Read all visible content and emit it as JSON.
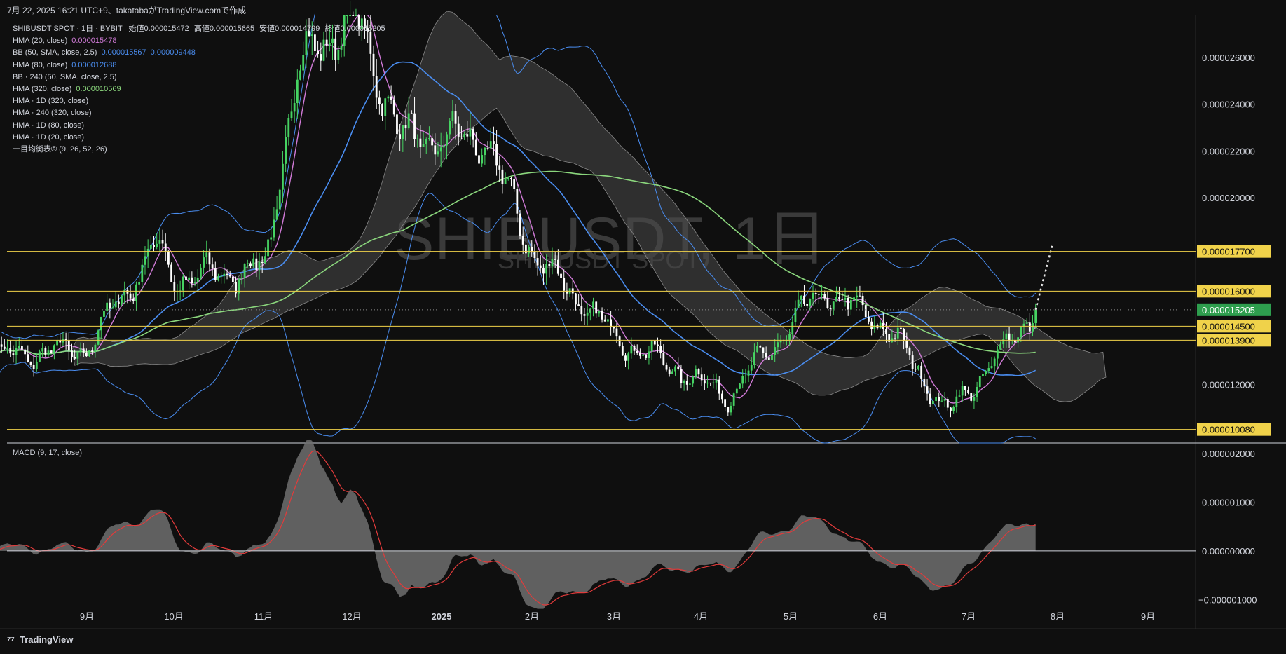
{
  "header": {
    "snapshot_line": "7月 22, 2025 16:21 UTC+9、takatabaがTradingView.comで作成",
    "watermark_symbol": "SHIBUSDT, 1日",
    "watermark_sub": "SHIBUSDT SPOT"
  },
  "legend": {
    "main": {
      "prefix": "SHIBUSDT SPOT · 1日 · BYBIT",
      "open_label": "始値",
      "open": "0.000015472",
      "high_label": "高値",
      "high": "0.000015665",
      "low_label": "安値",
      "low": "0.000014799",
      "close_label": "終値",
      "close": "0.000015205"
    },
    "indicators": [
      {
        "label": "HMA (20, close)",
        "value": "0.000015478",
        "color": "#d17bd8"
      },
      {
        "label": "BB (50, SMA, close, 2.5)",
        "value": "0.000015567",
        "value2": "0.000009448",
        "color": "#4a8df0"
      },
      {
        "label": "HMA (80, close)",
        "value": "0.000012688",
        "color": "#4a8df0"
      },
      {
        "label": "BB · 240 (50, SMA, close, 2.5)",
        "value": "",
        "color": ""
      },
      {
        "label": "HMA (320, close)",
        "value": "0.000010569",
        "color": "#8bd77d"
      },
      {
        "label": "HMA · 1D (320, close)",
        "value": "",
        "color": ""
      },
      {
        "label": "HMA · 240 (320, close)",
        "value": "",
        "color": ""
      },
      {
        "label": "HMA · 1D (80, close)",
        "value": "",
        "color": ""
      },
      {
        "label": "HMA · 1D (20, close)",
        "value": "",
        "color": ""
      },
      {
        "label": "一目均衡表® (9, 26, 52, 26)",
        "value": "",
        "color": ""
      }
    ]
  },
  "chart_data": [
    {
      "type": "candlestick",
      "title": "SHIBUSDT SPOT · 1日 · BYBIT",
      "x_ticks": [
        "9月",
        "10月",
        "11月",
        "12月",
        "2025",
        "2月",
        "3月",
        "4月",
        "5月",
        "6月",
        "7月",
        "8月",
        "9月"
      ],
      "y_ticks": [
        "0.000026000",
        "0.000024000",
        "0.000022000",
        "0.000020000",
        "0.000012000"
      ],
      "ylim": [
        9.5e-06,
        2.78e-05
      ],
      "horizontal_levels": [
        {
          "value": 1.77e-05,
          "label": "0.000017700",
          "color": "#f0d24a"
        },
        {
          "value": 1.6e-05,
          "label": "0.000016000",
          "color": "#f0d24a"
        },
        {
          "value": 1.45e-05,
          "label": "0.000014500",
          "color": "#f0d24a"
        },
        {
          "value": 1.39e-05,
          "label": "0.000013900",
          "color": "#f0d24a"
        },
        {
          "value": 1.008e-05,
          "label": "0.000010080",
          "color": "#f0d24a"
        }
      ],
      "last_price": {
        "value": 1.5205e-05,
        "label": "0.000015205",
        "color": "#2e9e4e"
      },
      "close_path_monthly": [
        {
          "x": "2024-08-01",
          "close": 1.32e-05
        },
        {
          "x": "2024-09-01",
          "close": 1.35e-05
        },
        {
          "x": "2024-09-25",
          "close": 1.8e-05
        },
        {
          "x": "2024-10-01",
          "close": 1.65e-05
        },
        {
          "x": "2024-11-01",
          "close": 1.7e-05
        },
        {
          "x": "2024-11-12",
          "close": 2.55e-05
        },
        {
          "x": "2024-12-01",
          "close": 2.8e-05
        },
        {
          "x": "2024-12-18",
          "close": 2.25e-05
        },
        {
          "x": "2025-01-15",
          "close": 2.25e-05
        },
        {
          "x": "2025-02-01",
          "close": 1.75e-05
        },
        {
          "x": "2025-03-01",
          "close": 1.4e-05
        },
        {
          "x": "2025-04-08",
          "close": 1.15e-05
        },
        {
          "x": "2025-05-10",
          "close": 1.6e-05
        },
        {
          "x": "2025-06-01",
          "close": 1.45e-05
        },
        {
          "x": "2025-06-22",
          "close": 1.08e-05
        },
        {
          "x": "2025-07-01",
          "close": 1.2e-05
        },
        {
          "x": "2025-07-22",
          "close": 1.52e-05
        }
      ],
      "colors": {
        "up": "#46d362",
        "down": "#ffffff",
        "bb": "#4a8df0",
        "hma20": "#d17bd8",
        "hma80": "#4a8df0",
        "hma320": "#8bd77d",
        "cloud": "#4a4a4a"
      }
    },
    {
      "type": "area",
      "title": "MACD (9, 17, close)",
      "y_ticks": [
        "0.000002000",
        "0.000001000",
        "0.000000000",
        "−0.000001000"
      ],
      "ylim": [
        -1.5e-06,
        2.1e-06
      ],
      "colors": {
        "histogram": "#6f6f6f",
        "signal": "#e23b3b",
        "zero": "#d1d4dc"
      }
    }
  ],
  "macd_label": "MACD (9, 17, close)",
  "brand": {
    "name": "TradingView"
  }
}
